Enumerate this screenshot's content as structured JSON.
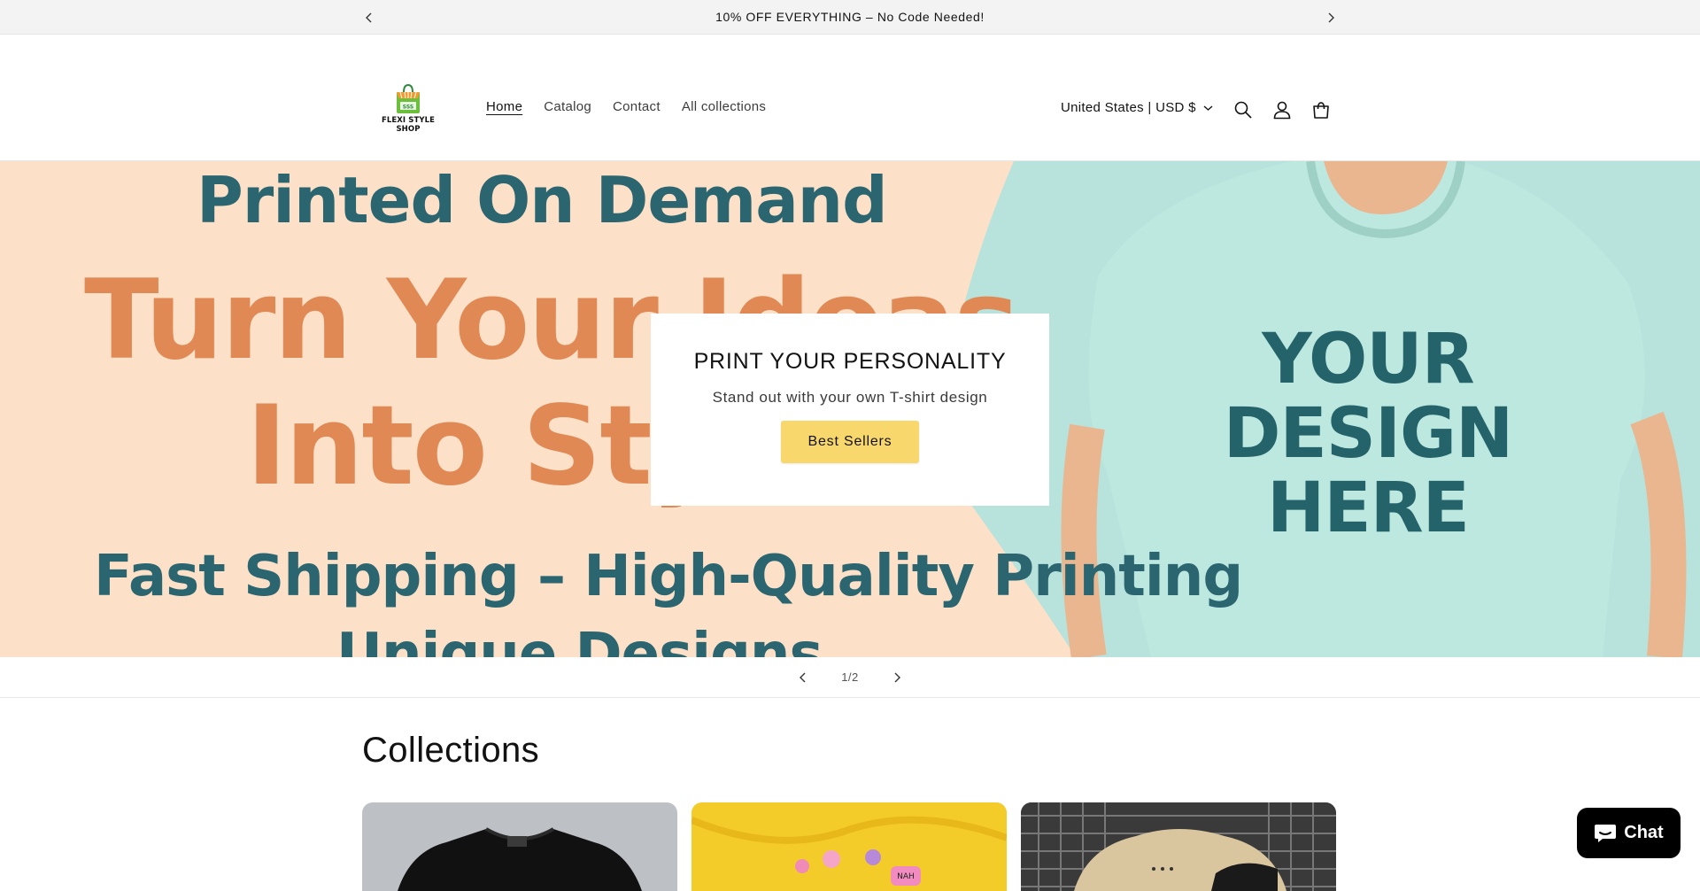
{
  "announcement": {
    "text": "10% OFF EVERYTHING – No Code Needed!",
    "prev_icon": "chevron-left-icon",
    "next_icon": "chevron-right-icon"
  },
  "header": {
    "logo_text": "FLEXI STYLE SHOP",
    "nav": [
      {
        "label": "Home",
        "active": true
      },
      {
        "label": "Catalog",
        "active": false
      },
      {
        "label": "Contact",
        "active": false
      },
      {
        "label": "All collections",
        "active": false
      }
    ],
    "country_selector": "United States | USD $",
    "icons": [
      "search-icon",
      "account-icon",
      "cart-icon"
    ]
  },
  "hero": {
    "banner": {
      "line1": "Printed On Demand",
      "line2": "Turn Your Ideas",
      "line3": "Into Style",
      "line4": "Fast Shipping – High-Quality Printing",
      "line5": "Unique Designs",
      "shirt_line1": "YOUR",
      "shirt_line2": "DESIGN",
      "shirt_line3": "HERE"
    },
    "card": {
      "heading": "PRINT YOUR PERSONALITY",
      "subtext": "Stand out with your own T-shirt design",
      "button_label": "Best Sellers"
    },
    "colors": {
      "peach": "#fde0c8",
      "teal_text": "#2a6570",
      "orange_text": "#e08955",
      "mint": "#b7e3dc",
      "button": "#f8d76c"
    }
  },
  "slider": {
    "counter": "1/2"
  },
  "collections": {
    "title": "Collections"
  },
  "chat": {
    "label": "Chat"
  }
}
